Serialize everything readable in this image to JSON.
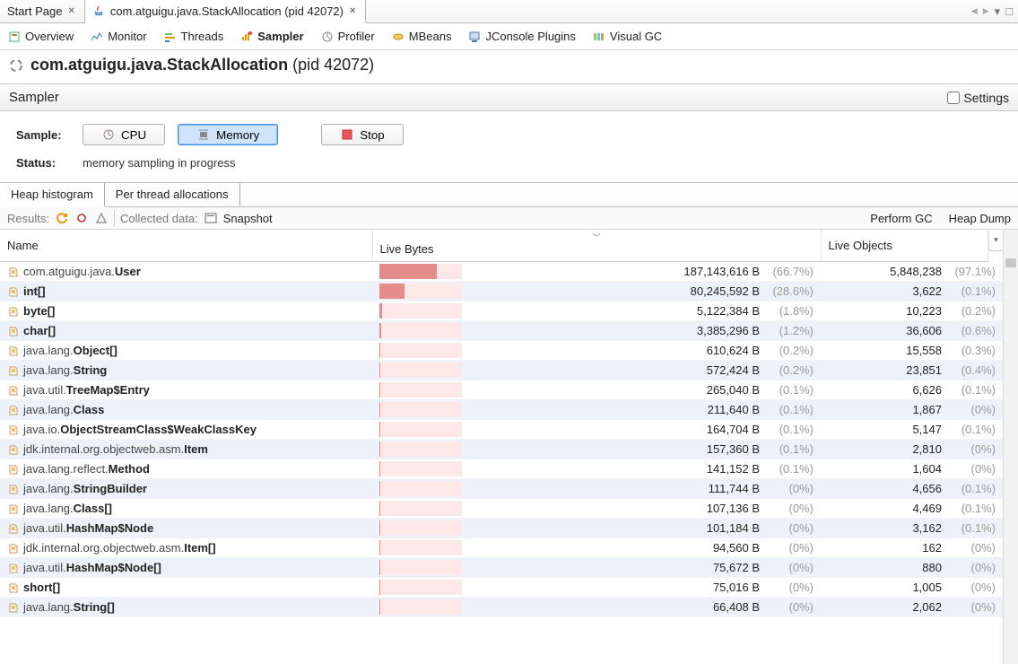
{
  "doc_tabs": [
    {
      "label": "Start Page"
    },
    {
      "label": "com.atguigu.java.StackAllocation (pid 42072)"
    }
  ],
  "toolbar": [
    {
      "id": "overview",
      "label": "Overview"
    },
    {
      "id": "monitor",
      "label": "Monitor"
    },
    {
      "id": "threads",
      "label": "Threads"
    },
    {
      "id": "sampler",
      "label": "Sampler"
    },
    {
      "id": "profiler",
      "label": "Profiler"
    },
    {
      "id": "mbeans",
      "label": "MBeans"
    },
    {
      "id": "jconsole",
      "label": "JConsole Plugins"
    },
    {
      "id": "visualgc",
      "label": "Visual GC"
    }
  ],
  "title": {
    "bold": "com.atguigu.java.StackAllocation",
    "suffix": "(pid 42072)"
  },
  "sampler": {
    "header": "Sampler",
    "settings_label": "Settings",
    "sample_label": "Sample:",
    "cpu_btn": "CPU",
    "memory_btn": "Memory",
    "stop_btn": "Stop",
    "status_label": "Status:",
    "status_value": "memory sampling in progress",
    "subtab_heap": "Heap histogram",
    "subtab_thread": "Per thread allocations",
    "results_label": "Results:",
    "collected_label": "Collected data:",
    "snapshot_btn": "Snapshot",
    "perform_gc": "Perform GC",
    "heap_dump": "Heap Dump"
  },
  "table": {
    "col_name": "Name",
    "col_bytes": "Live Bytes",
    "col_obj": "Live Objects",
    "rows": [
      {
        "pkg": "com.atguigu.java.",
        "cls": "User",
        "bytes": "187,143,616 B",
        "bpct": "(66.7%)",
        "bar": 70,
        "obj": "5,848,238",
        "opct": "(97.1%)"
      },
      {
        "pkg": "",
        "cls": "int[]",
        "bytes": "80,245,592 B",
        "bpct": "(28.6%)",
        "bar": 30,
        "obj": "3,622",
        "opct": "(0.1%)"
      },
      {
        "pkg": "",
        "cls": "byte[]",
        "bytes": "5,122,384 B",
        "bpct": "(1.8%)",
        "bar": 3,
        "obj": "10,223",
        "opct": "(0.2%)"
      },
      {
        "pkg": "",
        "cls": "char[]",
        "bytes": "3,385,296 B",
        "bpct": "(1.2%)",
        "bar": 2,
        "obj": "36,606",
        "opct": "(0.6%)"
      },
      {
        "pkg": "java.lang.",
        "cls": "Object[]",
        "bytes": "610,624 B",
        "bpct": "(0.2%)",
        "bar": 1,
        "obj": "15,558",
        "opct": "(0.3%)"
      },
      {
        "pkg": "java.lang.",
        "cls": "String",
        "bytes": "572,424 B",
        "bpct": "(0.2%)",
        "bar": 1,
        "obj": "23,851",
        "opct": "(0.4%)"
      },
      {
        "pkg": "java.util.",
        "cls": "TreeMap$Entry",
        "bytes": "265,040 B",
        "bpct": "(0.1%)",
        "bar": 1,
        "obj": "6,626",
        "opct": "(0.1%)"
      },
      {
        "pkg": "java.lang.",
        "cls": "Class",
        "bytes": "211,640 B",
        "bpct": "(0.1%)",
        "bar": 1,
        "obj": "1,867",
        "opct": "(0%)"
      },
      {
        "pkg": "java.io.",
        "cls": "ObjectStreamClass$WeakClassKey",
        "bytes": "164,704 B",
        "bpct": "(0.1%)",
        "bar": 1,
        "obj": "5,147",
        "opct": "(0.1%)"
      },
      {
        "pkg": "jdk.internal.org.objectweb.asm.",
        "cls": "Item",
        "bytes": "157,360 B",
        "bpct": "(0.1%)",
        "bar": 1,
        "obj": "2,810",
        "opct": "(0%)"
      },
      {
        "pkg": "java.lang.reflect.",
        "cls": "Method",
        "bytes": "141,152 B",
        "bpct": "(0.1%)",
        "bar": 1,
        "obj": "1,604",
        "opct": "(0%)"
      },
      {
        "pkg": "java.lang.",
        "cls": "StringBuilder",
        "bytes": "111,744 B",
        "bpct": "(0%)",
        "bar": 1,
        "obj": "4,656",
        "opct": "(0.1%)"
      },
      {
        "pkg": "java.lang.",
        "cls": "Class[]",
        "bytes": "107,136 B",
        "bpct": "(0%)",
        "bar": 1,
        "obj": "4,469",
        "opct": "(0.1%)"
      },
      {
        "pkg": "java.util.",
        "cls": "HashMap$Node",
        "bytes": "101,184 B",
        "bpct": "(0%)",
        "bar": 1,
        "obj": "3,162",
        "opct": "(0.1%)"
      },
      {
        "pkg": "jdk.internal.org.objectweb.asm.",
        "cls": "Item[]",
        "bytes": "94,560 B",
        "bpct": "(0%)",
        "bar": 1,
        "obj": "162",
        "opct": "(0%)"
      },
      {
        "pkg": "java.util.",
        "cls": "HashMap$Node[]",
        "bytes": "75,672 B",
        "bpct": "(0%)",
        "bar": 1,
        "obj": "880",
        "opct": "(0%)"
      },
      {
        "pkg": "",
        "cls": "short[]",
        "bytes": "75,016 B",
        "bpct": "(0%)",
        "bar": 1,
        "obj": "1,005",
        "opct": "(0%)"
      },
      {
        "pkg": "java.lang.",
        "cls": "String[]",
        "bytes": "66,408 B",
        "bpct": "(0%)",
        "bar": 1,
        "obj": "2,062",
        "opct": "(0%)"
      }
    ]
  }
}
